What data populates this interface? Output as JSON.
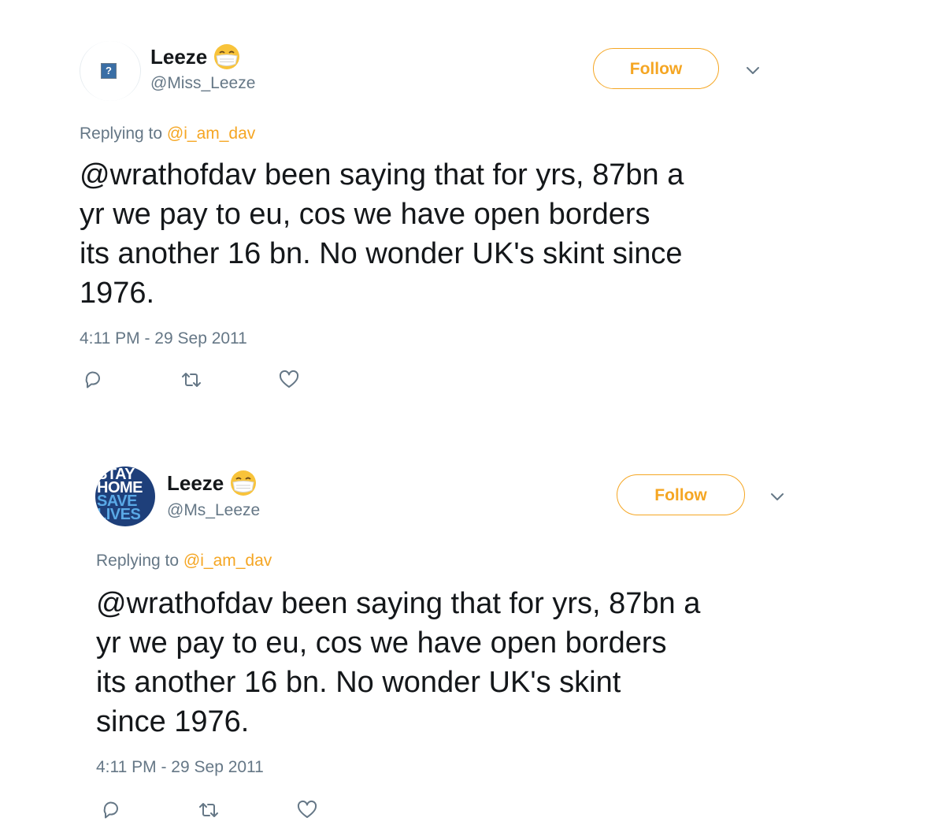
{
  "tweets": [
    {
      "display_name": "Leeze",
      "handle": "@Miss_Leeze",
      "follow_label": "Follow",
      "replying_prefix": "Replying to",
      "replying_to": "@i_am_dav",
      "text": "@wrathofdav been saying that for yrs, 87bn a\nyr we pay to eu, cos we have open borders\nits another 16 bn. No wonder UK's skint since\n1976.",
      "timestamp": "4:11 PM - 29 Sep 2011",
      "avatar_icon": "broken-image-icon"
    },
    {
      "display_name": "Leeze",
      "handle": "@Ms_Leeze",
      "follow_label": "Follow",
      "replying_prefix": "Replying to",
      "replying_to": "@i_am_dav",
      "text": "@wrathofdav been saying that for yrs, 87bn a\nyr we pay to eu, cos we have open borders\nits another 16 bn. No wonder UK's skint\nsince 1976.",
      "timestamp": "4:11 PM - 29 Sep 2011",
      "avatar_lines": [
        "STAY",
        "HOME",
        "SAVE",
        "LIVES"
      ]
    }
  ],
  "colors": {
    "accent": "#f5a623",
    "secondary_text": "#657786",
    "primary_text": "#14171a"
  },
  "icons": [
    "face-mask-emoji-icon",
    "chevron-down-icon",
    "reply-icon",
    "retweet-icon",
    "like-icon"
  ]
}
